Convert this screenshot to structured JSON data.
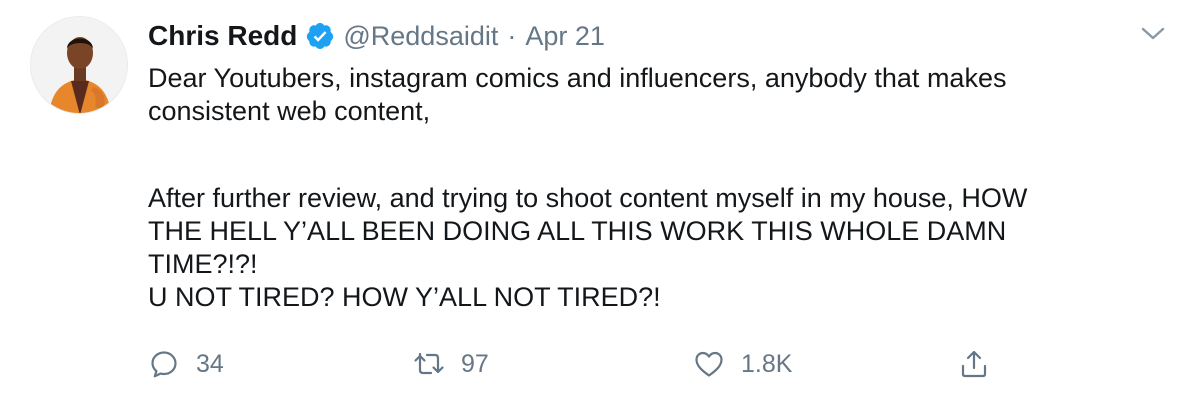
{
  "author": {
    "display_name": "Chris Redd",
    "handle": "@Reddsaidit",
    "separator": "·",
    "date": "Apr 21",
    "verified": true
  },
  "tweet": {
    "lines_paragraph_1": [
      "Dear Youtubers, instagram comics and influencers, anybody that makes",
      "consistent web content,"
    ],
    "lines_paragraph_2": [
      "After further review, and trying to shoot content myself in my house, HOW",
      "THE HELL Y’ALL BEEN DOING ALL THIS WORK THIS WHOLE DAMN",
      "TIME?!?!",
      "U NOT TIRED? HOW Y’ALL NOT TIRED?!"
    ]
  },
  "actions": {
    "reply_count": "34",
    "retweet_count": "97",
    "like_count": "1.8K"
  },
  "icons": {
    "avatar": "profile-photo",
    "verified": "verified-badge-icon",
    "caret": "chevron-down-icon",
    "reply": "reply-icon",
    "retweet": "retweet-icon",
    "like": "heart-icon",
    "share": "share-icon"
  },
  "colors": {
    "text": "#14171a",
    "secondary": "#657786",
    "verified_blue": "#1da1f2"
  }
}
